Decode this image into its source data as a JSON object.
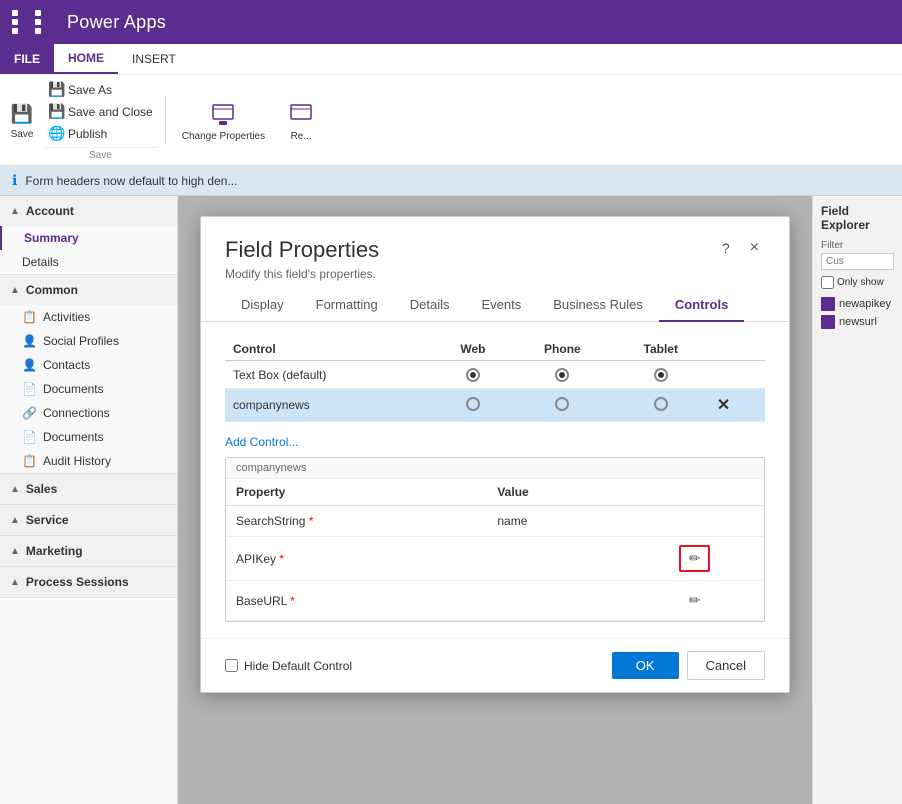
{
  "app": {
    "title": "Power Apps"
  },
  "ribbon": {
    "tabs": [
      "FILE",
      "HOME",
      "INSERT"
    ],
    "active_tab": "HOME",
    "buttons": {
      "save": "Save",
      "save_as": "Save As",
      "save_and_close": "Save and Close",
      "publish": "Publish",
      "change_properties": "Change\nProperties",
      "remove": "Re..."
    },
    "save_group_label": "Save"
  },
  "info_bar": {
    "message": "Form headers now default to high den..."
  },
  "sidebar": {
    "account_section": "Account",
    "account_items": [
      {
        "label": "Summary",
        "active": true
      },
      {
        "label": "Details",
        "active": false
      }
    ],
    "common_section": "Common",
    "common_items": [
      {
        "label": "Activities",
        "icon": "📋"
      },
      {
        "label": "Social Profiles",
        "icon": "👤"
      },
      {
        "label": "Contacts",
        "icon": "👤"
      },
      {
        "label": "Documents",
        "icon": "📄"
      },
      {
        "label": "Connections",
        "icon": "🔗"
      },
      {
        "label": "Documents",
        "icon": "📄"
      },
      {
        "label": "Audit History",
        "icon": "📋"
      }
    ],
    "sales_section": "Sales",
    "service_section": "Service",
    "marketing_section": "Marketing",
    "process_sessions_section": "Process Sessions"
  },
  "right_panel": {
    "title": "Field Explorer",
    "filter_label": "Filter",
    "filter_placeholder": "Cus",
    "only_show_label": "Only show",
    "items": [
      {
        "label": "newapikey"
      },
      {
        "label": "newsurl"
      }
    ]
  },
  "dialog": {
    "title": "Field Properties",
    "subtitle": "Modify this field's properties.",
    "help_label": "?",
    "close_label": "×",
    "tabs": [
      "Display",
      "Formatting",
      "Details",
      "Events",
      "Business Rules",
      "Controls"
    ],
    "active_tab": "Controls",
    "controls_table": {
      "headers": [
        "Control",
        "Web",
        "Phone",
        "Tablet"
      ],
      "rows": [
        {
          "name": "Text Box (default)",
          "web": "filled",
          "phone": "filled",
          "tablet": "filled",
          "selected": false
        },
        {
          "name": "companynews",
          "web": "empty",
          "phone": "empty",
          "tablet": "empty",
          "selected": true,
          "removable": true
        }
      ]
    },
    "add_control_label": "Add Control...",
    "props_section_title": "companynews",
    "props_table": {
      "headers": [
        "Property",
        "Value"
      ],
      "rows": [
        {
          "property": "SearchString",
          "required": true,
          "value": "name",
          "has_edit": false
        },
        {
          "property": "APIKey",
          "required": true,
          "value": "",
          "has_edit": true,
          "edit_highlighted": true
        },
        {
          "property": "BaseURL",
          "required": true,
          "value": "",
          "has_edit": true,
          "edit_highlighted": false
        }
      ]
    },
    "hide_default_control_label": "Hide Default Control",
    "ok_label": "OK",
    "cancel_label": "Cancel"
  }
}
